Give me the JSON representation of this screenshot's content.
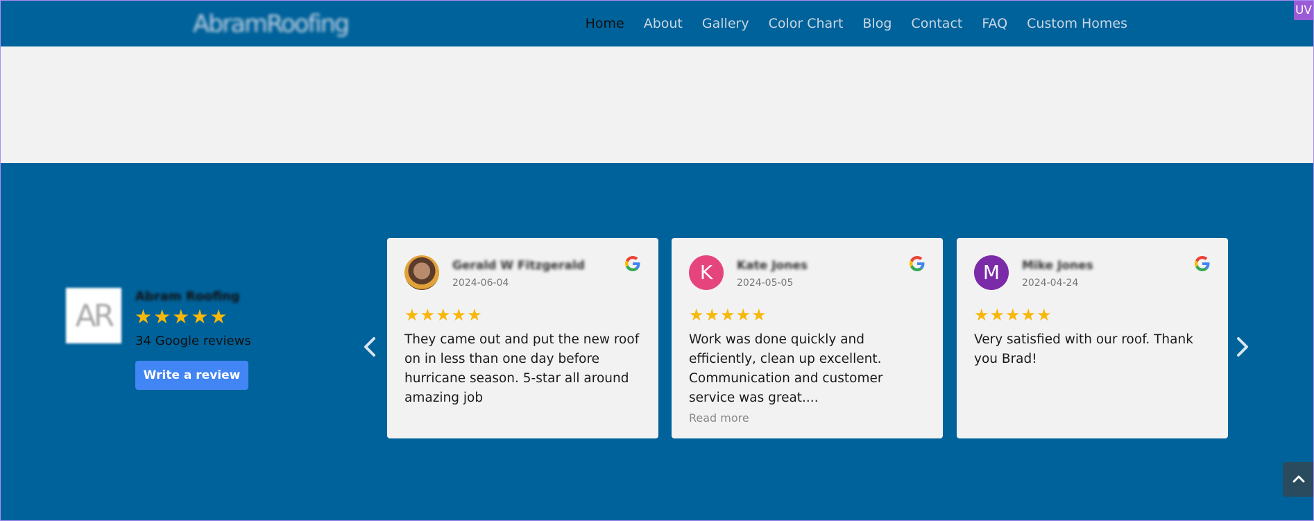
{
  "header": {
    "logo_text": "AbramRoofing",
    "nav": [
      {
        "label": "Home",
        "active": true
      },
      {
        "label": "About"
      },
      {
        "label": "Gallery"
      },
      {
        "label": "Color Chart"
      },
      {
        "label": "Blog"
      },
      {
        "label": "Contact"
      },
      {
        "label": "FAQ"
      },
      {
        "label": "Custom Homes"
      }
    ],
    "badge": "UV"
  },
  "summary": {
    "logo_initials": "AR",
    "business_name": "Abram Roofing",
    "rating": 5,
    "count_text": "34 Google reviews",
    "write_review_label": "Write a review"
  },
  "reviews": [
    {
      "name": "Gerald W Fitzgerald",
      "date": "2024-06-04",
      "avatar_type": "photo",
      "rating": 5,
      "text": "They came out and put the new roof on in less than one day before hurricane season. 5-star all around amazing job"
    },
    {
      "name": "Kate Jones",
      "date": "2024-05-05",
      "avatar_type": "initial",
      "avatar_initial": "K",
      "avatar_color": "#e5447c",
      "rating": 5,
      "text": "Work was done quickly and efficiently, clean up excellent.\nCommunication and customer service was great....",
      "read_more": "Read more"
    },
    {
      "name": "Mike Jones",
      "date": "2024-04-24",
      "avatar_type": "initial",
      "avatar_initial": "M",
      "avatar_color": "#7b2aa8",
      "rating": 5,
      "text": "Very satisfied with our roof. Thank you Brad!"
    }
  ],
  "colors": {
    "brand_blue": "#00629b",
    "star": "#f7b80a",
    "button": "#4285f4"
  }
}
